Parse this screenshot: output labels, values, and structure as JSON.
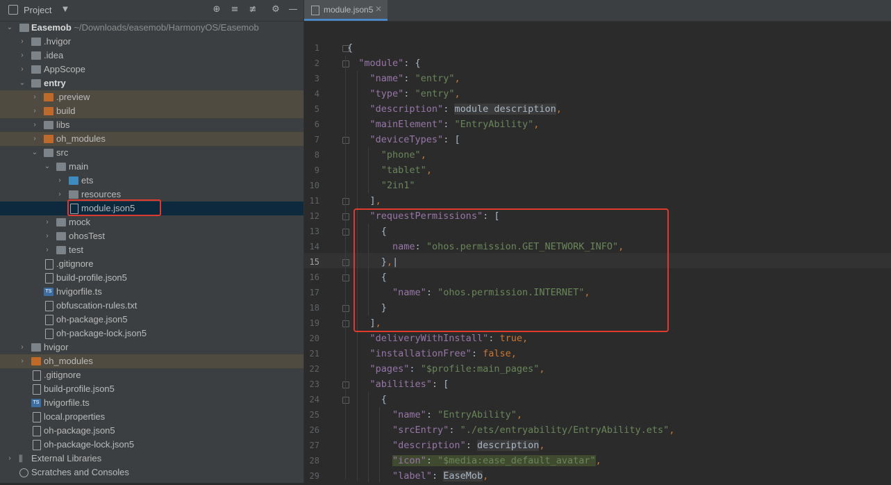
{
  "project_panel": {
    "title": "Project",
    "icons": [
      "locate-icon",
      "expand-all-icon",
      "collapse-all-icon",
      "gear-icon",
      "hide-icon"
    ]
  },
  "tree": [
    {
      "label": "Easemob",
      "path": "~/Downloads/easemob/HarmonyOS/Easemob",
      "bold": true
    },
    {
      "label": ".hvigor"
    },
    {
      "label": ".idea"
    },
    {
      "label": "AppScope"
    },
    {
      "label": "entry",
      "bold": true
    },
    {
      "label": ".preview"
    },
    {
      "label": "build"
    },
    {
      "label": "libs"
    },
    {
      "label": "oh_modules"
    },
    {
      "label": "src"
    },
    {
      "label": "main"
    },
    {
      "label": "ets"
    },
    {
      "label": "resources"
    },
    {
      "label": "module.json5"
    },
    {
      "label": "mock"
    },
    {
      "label": "ohosTest"
    },
    {
      "label": "test"
    },
    {
      "label": ".gitignore"
    },
    {
      "label": "build-profile.json5"
    },
    {
      "label": "hvigorfile.ts"
    },
    {
      "label": "obfuscation-rules.txt"
    },
    {
      "label": "oh-package.json5"
    },
    {
      "label": "oh-package-lock.json5"
    },
    {
      "label": "hvigor"
    },
    {
      "label": "oh_modules"
    },
    {
      "label": ".gitignore"
    },
    {
      "label": "build-profile.json5"
    },
    {
      "label": "hvigorfile.ts"
    },
    {
      "label": "local.properties"
    },
    {
      "label": "oh-package.json5"
    },
    {
      "label": "oh-package-lock.json5"
    },
    {
      "label": "External Libraries"
    },
    {
      "label": "Scratches and Consoles"
    }
  ],
  "editor": {
    "tab_label": "module.json5",
    "line_numbers": [
      "1",
      "2",
      "3",
      "4",
      "5",
      "6",
      "7",
      "8",
      "9",
      "10",
      "11",
      "12",
      "13",
      "14",
      "15",
      "16",
      "17",
      "18",
      "19",
      "20",
      "21",
      "22",
      "23",
      "24",
      "25",
      "26",
      "27",
      "28",
      "29"
    ],
    "current_line": "15"
  },
  "colors": {
    "keyword": "#9876aa",
    "string": "#6a8759",
    "punct": "#cc7832",
    "highlight_box": "#e03a2e",
    "selection": "#0d293e"
  }
}
